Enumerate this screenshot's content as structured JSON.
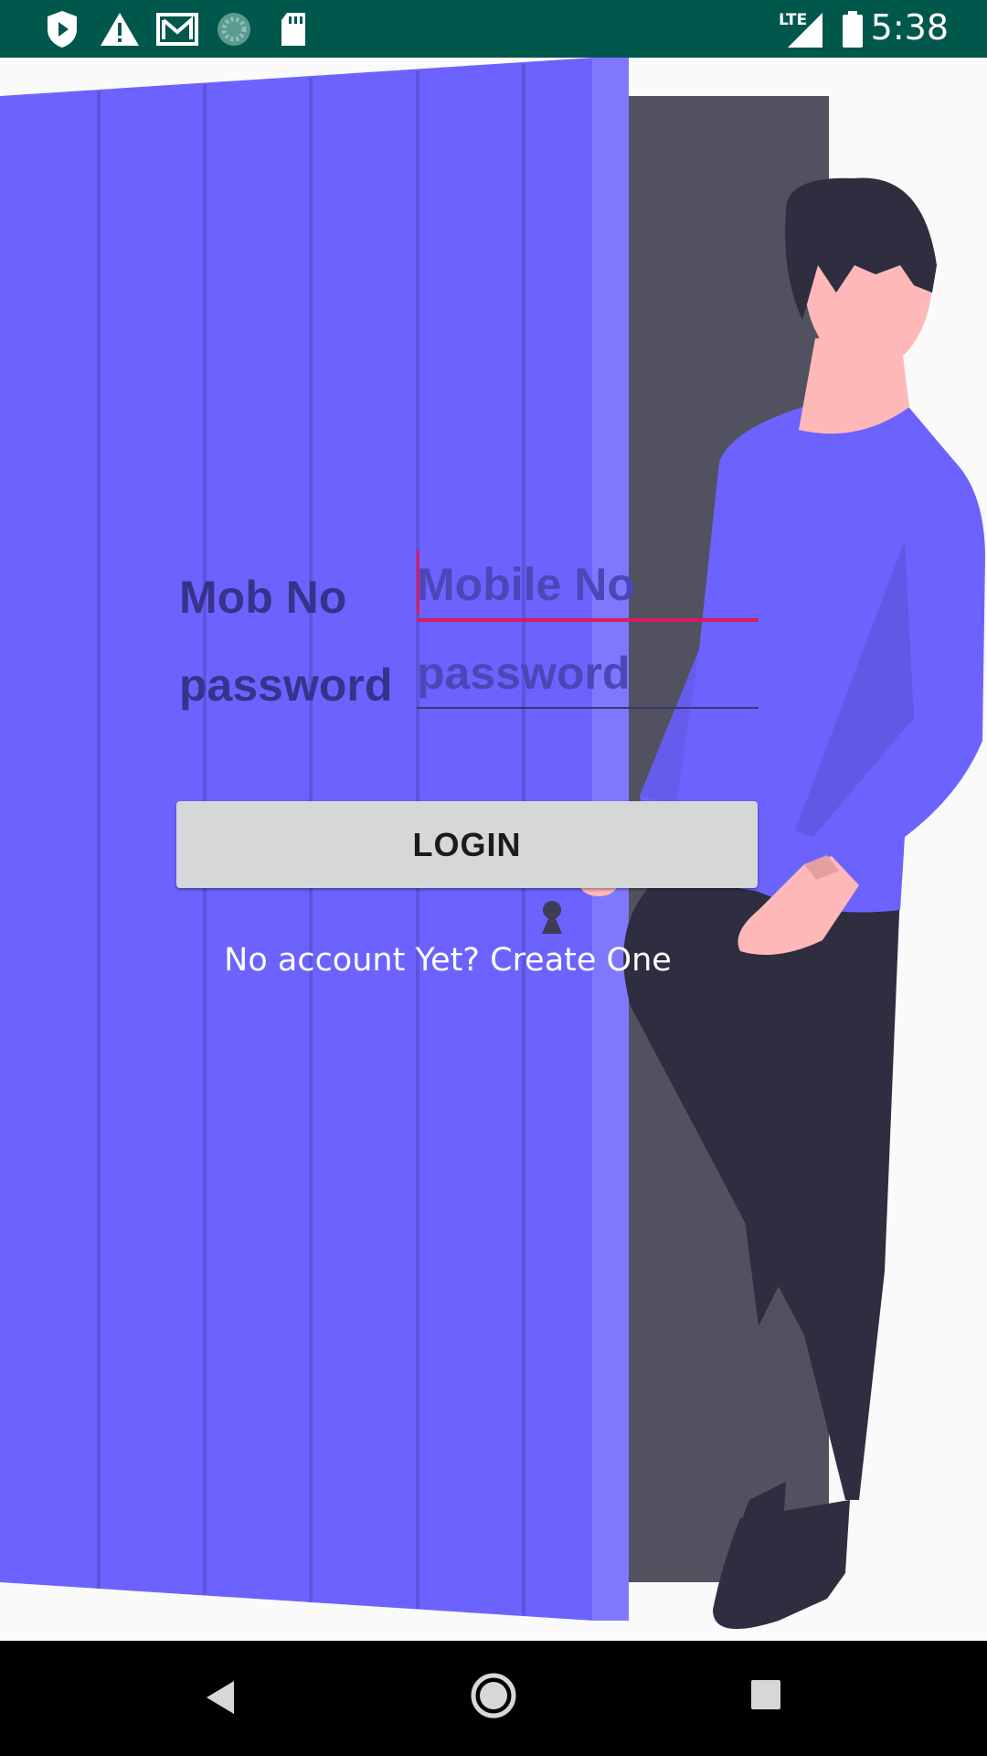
{
  "status_bar": {
    "time": "5:38",
    "network": "LTE",
    "icons": [
      "shield-play-icon",
      "warning-icon",
      "gmail-icon",
      "sync-progress-icon",
      "sd-card-icon",
      "signal-icon",
      "battery-icon"
    ],
    "background_color": "#00574b"
  },
  "login": {
    "mobile_label": "Mob No",
    "mobile_placeholder": "Mobile No",
    "mobile_value": "",
    "password_label": "password",
    "password_placeholder": "password",
    "password_value": "",
    "login_button": "LOGIN",
    "create_account_link": "No account Yet? Create One"
  },
  "theme": {
    "door_color": "#6c63ff",
    "doorway_color": "#52515f",
    "focus_color": "#d81b60",
    "button_color": "#d6d7d7"
  },
  "nav_bar": {
    "buttons": [
      "back-icon",
      "home-icon",
      "recents-icon"
    ]
  }
}
